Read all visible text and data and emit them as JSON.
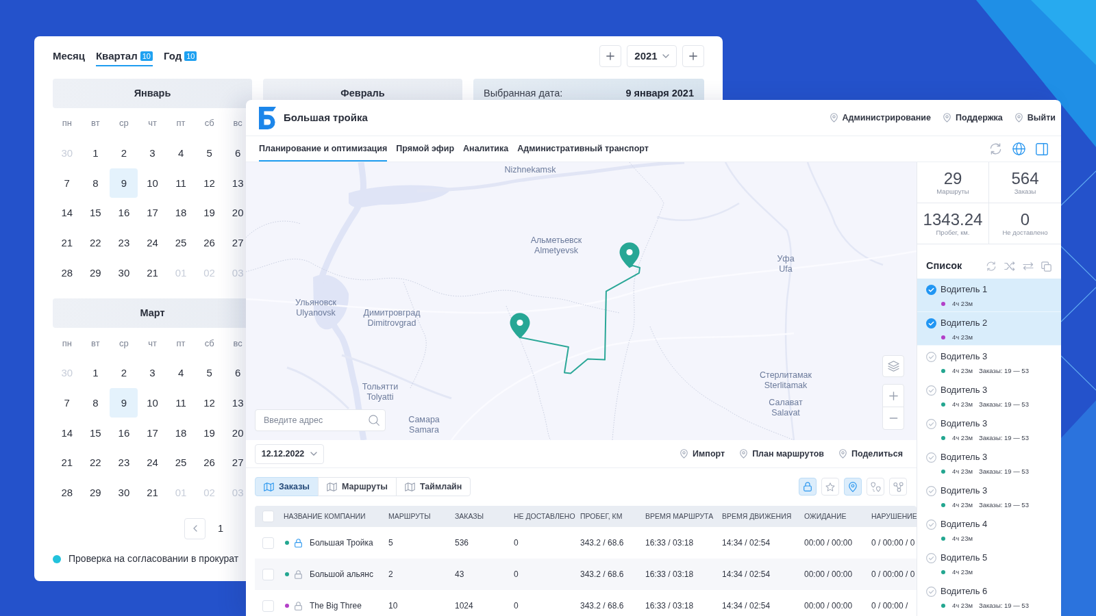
{
  "calendar_window": {
    "period_tabs": [
      {
        "label": "Месяц",
        "selected": false
      },
      {
        "label": "Квартал",
        "badge": "10",
        "selected": true
      },
      {
        "label": "Год",
        "badge": "10",
        "selected": false
      }
    ],
    "year": "2021",
    "selected_date": {
      "label": "Выбранная дата:",
      "value": "9 января 2021"
    },
    "months": [
      {
        "name": "Январь",
        "weekdays": [
          "пн",
          "вт",
          "ср",
          "чт",
          "пт",
          "сб",
          "вс"
        ],
        "days": [
          {
            "day": "30",
            "muted": true,
            "selected": false
          },
          {
            "day": "1",
            "muted": false,
            "selected": false
          },
          {
            "day": "2",
            "muted": false,
            "selected": false
          },
          {
            "day": "3",
            "muted": false,
            "selected": false
          },
          {
            "day": "4",
            "muted": false,
            "selected": false
          },
          {
            "day": "5",
            "muted": false,
            "selected": false
          },
          {
            "day": "6",
            "muted": false,
            "selected": false
          },
          {
            "day": "7",
            "muted": false,
            "selected": false
          },
          {
            "day": "8",
            "muted": false,
            "selected": false
          },
          {
            "day": "9",
            "muted": false,
            "selected": true
          },
          {
            "day": "10",
            "muted": false,
            "selected": false
          },
          {
            "day": "11",
            "muted": false,
            "selected": false
          },
          {
            "day": "12",
            "muted": false,
            "selected": false
          },
          {
            "day": "13",
            "muted": false,
            "selected": false
          },
          {
            "day": "14",
            "muted": false,
            "selected": false
          },
          {
            "day": "15",
            "muted": false,
            "selected": false
          },
          {
            "day": "16",
            "muted": false,
            "selected": false
          },
          {
            "day": "17",
            "muted": false,
            "selected": false
          },
          {
            "day": "18",
            "muted": false,
            "selected": false
          },
          {
            "day": "19",
            "muted": false,
            "selected": false
          },
          {
            "day": "20",
            "muted": false,
            "selected": false
          },
          {
            "day": "21",
            "muted": false,
            "selected": false
          },
          {
            "day": "22",
            "muted": false,
            "selected": false
          },
          {
            "day": "23",
            "muted": false,
            "selected": false
          },
          {
            "day": "24",
            "muted": false,
            "selected": false
          },
          {
            "day": "25",
            "muted": false,
            "selected": false
          },
          {
            "day": "26",
            "muted": false,
            "selected": false
          },
          {
            "day": "27",
            "muted": false,
            "selected": false
          },
          {
            "day": "28",
            "muted": false,
            "selected": false
          },
          {
            "day": "29",
            "muted": false,
            "selected": false
          },
          {
            "day": "30",
            "muted": false,
            "selected": false
          },
          {
            "day": "21",
            "muted": false,
            "selected": false
          },
          {
            "day": "01",
            "muted": true,
            "selected": false
          },
          {
            "day": "02",
            "muted": true,
            "selected": false
          },
          {
            "day": "03",
            "muted": true,
            "selected": false
          }
        ]
      },
      {
        "name": "Февраль"
      },
      {
        "name": "Март",
        "weekdays": [
          "пн",
          "вт",
          "ср",
          "чт",
          "пт",
          "сб",
          "вс"
        ],
        "days": [
          {
            "day": "30",
            "muted": true,
            "selected": false
          },
          {
            "day": "1",
            "muted": false,
            "selected": false
          },
          {
            "day": "2",
            "muted": false,
            "selected": false
          },
          {
            "day": "3",
            "muted": false,
            "selected": false
          },
          {
            "day": "4",
            "muted": false,
            "selected": false
          },
          {
            "day": "5",
            "muted": false,
            "selected": false
          },
          {
            "day": "6",
            "muted": false,
            "selected": false
          },
          {
            "day": "7",
            "muted": false,
            "selected": false
          },
          {
            "day": "8",
            "muted": false,
            "selected": false
          },
          {
            "day": "9",
            "muted": false,
            "selected": true
          },
          {
            "day": "10",
            "muted": false,
            "selected": false
          },
          {
            "day": "11",
            "muted": false,
            "selected": false
          },
          {
            "day": "12",
            "muted": false,
            "selected": false
          },
          {
            "day": "13",
            "muted": false,
            "selected": false
          },
          {
            "day": "14",
            "muted": false,
            "selected": false
          },
          {
            "day": "15",
            "muted": false,
            "selected": false
          },
          {
            "day": "16",
            "muted": false,
            "selected": false
          },
          {
            "day": "17",
            "muted": false,
            "selected": false
          },
          {
            "day": "18",
            "muted": false,
            "selected": false
          },
          {
            "day": "19",
            "muted": false,
            "selected": false
          },
          {
            "day": "20",
            "muted": false,
            "selected": false
          },
          {
            "day": "21",
            "muted": false,
            "selected": false
          },
          {
            "day": "22",
            "muted": false,
            "selected": false
          },
          {
            "day": "23",
            "muted": false,
            "selected": false
          },
          {
            "day": "24",
            "muted": false,
            "selected": false
          },
          {
            "day": "25",
            "muted": false,
            "selected": false
          },
          {
            "day": "26",
            "muted": false,
            "selected": false
          },
          {
            "day": "27",
            "muted": false,
            "selected": false
          },
          {
            "day": "28",
            "muted": false,
            "selected": false
          },
          {
            "day": "29",
            "muted": false,
            "selected": false
          },
          {
            "day": "30",
            "muted": false,
            "selected": false
          },
          {
            "day": "21",
            "muted": false,
            "selected": false
          },
          {
            "day": "01",
            "muted": true,
            "selected": false
          },
          {
            "day": "02",
            "muted": true,
            "selected": false
          },
          {
            "day": "03",
            "muted": true,
            "selected": false
          }
        ]
      }
    ],
    "pagination": {
      "pages": [
        "1"
      ]
    },
    "legend": [
      {
        "label": "Проверка на согласовании в прокурат",
        "color": "#22c2dc"
      }
    ]
  },
  "app_window": {
    "app_name": "Большая тройка",
    "header_links": [
      "Администрирование",
      "Поддержка",
      "Выйти"
    ],
    "nav_tabs": [
      {
        "label": "Планирование и оптимизация",
        "selected": true
      },
      {
        "label": "Прямой эфир",
        "selected": false
      },
      {
        "label": "Аналитика",
        "selected": false
      },
      {
        "label": "Административный транспорт",
        "selected": false
      }
    ],
    "map": {
      "labels": [
        {
          "lines": [
            "Nizhnekamsk"
          ]
        },
        {
          "lines": [
            "Альметьевск",
            "Almetyevsk"
          ]
        },
        {
          "lines": [
            "Уфа",
            "Ufa"
          ]
        },
        {
          "lines": [
            "Ульяновск",
            "Ulyanovsk"
          ]
        },
        {
          "lines": [
            "Димитровград",
            "Dimitrovgrad"
          ]
        },
        {
          "lines": [
            "Стерлитамак",
            "Sterlitamak"
          ]
        },
        {
          "lines": [
            "Тольятти",
            "Tolyatti"
          ]
        },
        {
          "lines": [
            "Салават",
            "Salavat"
          ]
        },
        {
          "lines": [
            "Самара",
            "Samara"
          ]
        }
      ],
      "search": {
        "placeholder": "Введите адрес"
      }
    },
    "date_select": "12.12.2022",
    "actions": [
      "Импорт",
      "План маршрутов",
      "Поделиться"
    ],
    "view_tabs": [
      {
        "label": "Заказы",
        "selected": true
      },
      {
        "label": "Маршруты",
        "selected": false
      },
      {
        "label": "Таймлайн",
        "selected": false
      }
    ],
    "view_tools": [
      {
        "kind": "lock",
        "on": true
      },
      {
        "kind": "star",
        "on": false
      },
      {
        "kind": "pin",
        "on": true
      },
      {
        "kind": "route",
        "on": false
      },
      {
        "kind": "nodes",
        "on": false
      }
    ],
    "table": {
      "select_all_checked": false,
      "columns": [
        "НАЗВАНИЕ КОМПАНИИ",
        "МАРШРУТЫ",
        "ЗАКАЗЫ",
        "НЕ ДОСТАВЛЕНО",
        "ПРОБЕГ, КМ",
        "ВРЕМЯ МАРШРУТА",
        "ВРЕМЯ ДВИЖЕНИЯ",
        "ОЖИДАНИЕ",
        "НАРУШЕНИЕ"
      ],
      "rows": [
        {
          "checked": false,
          "color": "#23a690",
          "locked": true,
          "cells": [
            "Большая Тройка",
            "5",
            "536",
            "0",
            "343.2 / 68.6",
            "16:33 / 03:18",
            "14:34 / 02:54",
            "00:00 / 00:00",
            "0 / 00:00 / 0"
          ]
        },
        {
          "checked": false,
          "color": "#23a690",
          "locked": false,
          "cells": [
            "Большой альянс",
            "2",
            "43",
            "0",
            "343.2 / 68.6",
            "16:33 / 03:18",
            "14:34 / 02:54",
            "00:00 / 00:00",
            "0 / 00:00 / 0"
          ]
        },
        {
          "checked": false,
          "color": "#b340c8",
          "locked": false,
          "cells": [
            "The Big Three",
            "10",
            "1024",
            "0",
            "343.2 / 68.6",
            "16:33 / 03:18",
            "14:34 / 02:54",
            "00:00 / 00:00",
            "0 / 00:00 /"
          ]
        }
      ]
    },
    "stats": [
      {
        "value": "29",
        "label": "Маршруты"
      },
      {
        "value": "564",
        "label": "Заказы"
      },
      {
        "value": "1343.24",
        "label": "Пробег, км."
      },
      {
        "value": "0",
        "label": "Не доставлено"
      }
    ],
    "list": {
      "title": "Список",
      "items": [
        {
          "name": "Водитель 1",
          "selected": true,
          "color": "#b340c8",
          "duration": "4ч 23м"
        },
        {
          "name": "Водитель 2",
          "selected": true,
          "color": "#b340c8",
          "duration": "4ч 23м"
        },
        {
          "name": "Водитель 3",
          "selected": false,
          "color": "#23a690",
          "duration": "4ч 23м",
          "orders": "Заказы: 19 — 53"
        },
        {
          "name": "Водитель 3",
          "selected": false,
          "color": "#23a690",
          "duration": "4ч 23м",
          "orders": "Заказы: 19 — 53"
        },
        {
          "name": "Водитель 3",
          "selected": false,
          "color": "#23a690",
          "duration": "4ч 23м",
          "orders": "Заказы: 19 — 53"
        },
        {
          "name": "Водитель 3",
          "selected": false,
          "color": "#23a690",
          "duration": "4ч 23м",
          "orders": "Заказы: 19 — 53"
        },
        {
          "name": "Водитель 3",
          "selected": false,
          "color": "#23a690",
          "duration": "4ч 23м",
          "orders": "Заказы: 19 — 53"
        },
        {
          "name": "Водитель 4",
          "selected": false,
          "color": "#23a690",
          "duration": "4ч 23м"
        },
        {
          "name": "Водитель 5",
          "selected": false,
          "color": "#23a690",
          "duration": "4ч 23м"
        },
        {
          "name": "Водитель 6",
          "selected": false,
          "color": "#23a690",
          "duration": "4ч 23м",
          "orders": "Заказы: 19 — 53"
        }
      ]
    }
  }
}
